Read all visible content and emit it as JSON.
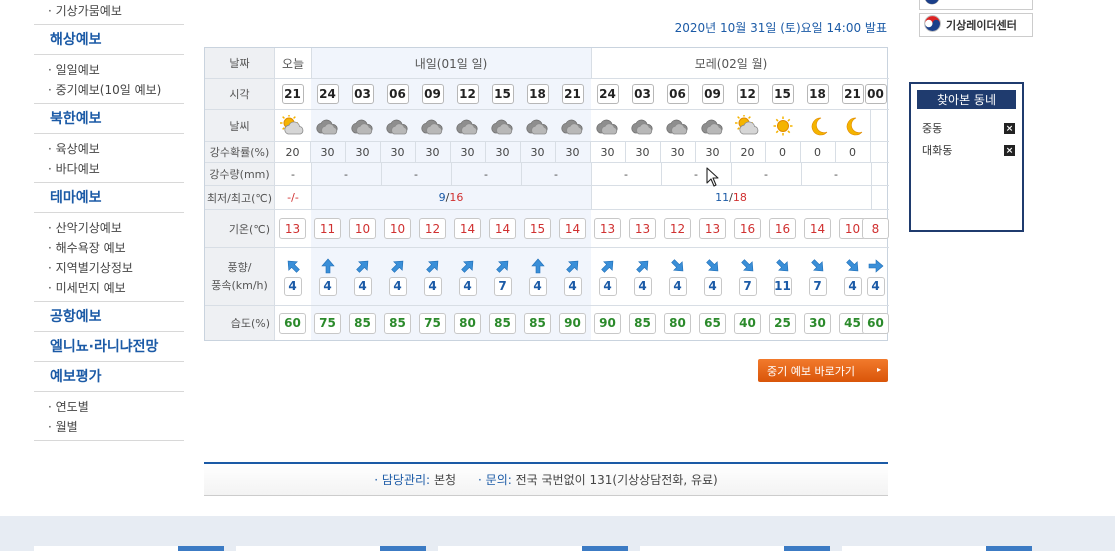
{
  "nav": {
    "top_item": "· 기상가뭄예보",
    "sections": [
      {
        "title": "해상예보",
        "items": [
          "· 일일예보",
          "· 중기예보(10일 예보)"
        ]
      },
      {
        "title": "북한예보",
        "items": [
          "· 육상예보",
          "· 바다예보"
        ]
      },
      {
        "title": "테마예보",
        "items": [
          "· 산악기상예보",
          "· 해수욕장 예보",
          "· 지역별기상정보",
          "· 미세먼지 예보"
        ]
      },
      {
        "title": "공항예보",
        "items": []
      },
      {
        "title": "엘니뇨·라니냐전망",
        "items": []
      },
      {
        "title": "예보평가",
        "items": [
          "· 연도별",
          "· 월별"
        ]
      }
    ]
  },
  "announce": "2020년 10월 31일 (토)요일 14:00 발표",
  "table": {
    "labels": {
      "date": "날짜",
      "time": "시각",
      "weather": "날씨",
      "pop": "강수확률(%)",
      "rain": "강수량(mm)",
      "minmax": "최저/최고(℃)",
      "temp": "기온(℃)",
      "wind_top": "풍향/",
      "wind_bottom": "풍속(km/h)",
      "humidity": "습도(%)"
    },
    "days": {
      "today": "오늘",
      "tomorrow": "내일(01일 일)",
      "after": "모레(02일 월)"
    },
    "times": [
      "21",
      "24",
      "03",
      "06",
      "09",
      "12",
      "15",
      "18",
      "21",
      "24",
      "03",
      "06",
      "09",
      "12",
      "15",
      "18",
      "21",
      "00"
    ],
    "weather_icons": [
      "partly-cloudy-icon",
      "cloudy-icon",
      "cloudy-icon",
      "cloudy-icon",
      "cloudy-icon",
      "cloudy-icon",
      "cloudy-icon",
      "cloudy-icon",
      "cloudy-icon",
      "cloudy-icon",
      "cloudy-icon",
      "cloudy-icon",
      "cloudy-icon",
      "partly-cloudy-icon",
      "sunny-icon",
      "moon-icon",
      "moon-icon"
    ],
    "pop": [
      "20",
      "30",
      "30",
      "30",
      "30",
      "30",
      "30",
      "30",
      "30",
      "30",
      "30",
      "30",
      "30",
      "20",
      "0",
      "0",
      "0"
    ],
    "rain": [
      "-",
      "-",
      "-",
      "-",
      "-",
      "-",
      "-",
      "-",
      "-"
    ],
    "minmax": {
      "today": "-/-",
      "tomorrow_min": "9",
      "tomorrow_sep": "/",
      "tomorrow_max": "16",
      "after_min": "11",
      "after_sep": "/",
      "after_max": "18"
    },
    "temps": [
      "13",
      "11",
      "10",
      "10",
      "12",
      "14",
      "14",
      "15",
      "14",
      "13",
      "13",
      "12",
      "13",
      "16",
      "16",
      "14",
      "10",
      "8"
    ],
    "wind_dirs": [
      "NW",
      "N",
      "NE",
      "NE",
      "NE",
      "NE",
      "NE",
      "N",
      "NE",
      "NE",
      "NE",
      "SE",
      "SE",
      "SE",
      "SE",
      "SE",
      "SE",
      "E"
    ],
    "wind_speeds": [
      "4",
      "4",
      "4",
      "4",
      "4",
      "4",
      "7",
      "4",
      "4",
      "4",
      "4",
      "4",
      "4",
      "7",
      "11",
      "7",
      "4",
      "4"
    ],
    "humidity": [
      "60",
      "75",
      "85",
      "85",
      "75",
      "80",
      "85",
      "85",
      "90",
      "90",
      "85",
      "80",
      "65",
      "40",
      "25",
      "30",
      "45",
      "60"
    ]
  },
  "mid_button": "중기 예보 바로가기",
  "mid_button_arrow": "▸",
  "footer": {
    "k1": "· 담당관리:",
    "v1": "본청",
    "k2": "· 문의:",
    "v2": "전국 국번없이 131(기상상담전화, 유료)"
  },
  "right": {
    "link_label": "기상레이더센터",
    "find_title": "찾아본 동네",
    "places": [
      "중동",
      "대화동"
    ],
    "remove": "×"
  },
  "colors": {
    "primary": "#1b5aa6",
    "temp": "#d03030",
    "humidity": "#2b8a2b",
    "button": "#e8661a",
    "panel": "#1f3b6e",
    "min": "#1b5aa6",
    "max": "#d03030"
  }
}
